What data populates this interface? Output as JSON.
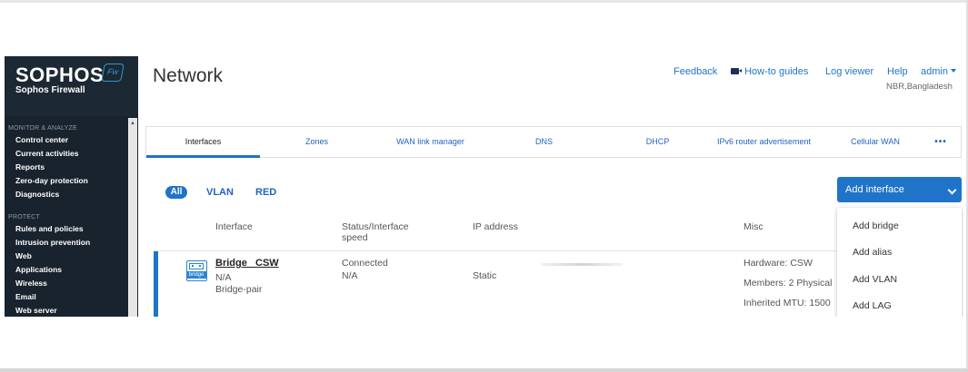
{
  "sidebar": {
    "brand": "SOPHOS",
    "badge": "Fw",
    "subtitle": "Sophos Firewall",
    "sections": [
      {
        "title": "MONITOR & ANALYZE",
        "items": [
          "Control center",
          "Current activities",
          "Reports",
          "Zero-day protection",
          "Diagnostics"
        ]
      },
      {
        "title": "PROTECT",
        "items": [
          "Rules and policies",
          "Intrusion prevention",
          "Web",
          "Applications",
          "Wireless",
          "Email",
          "Web server"
        ]
      }
    ]
  },
  "header": {
    "title": "Network",
    "links": {
      "feedback": "Feedback",
      "howto": "How-to guides",
      "log_viewer": "Log viewer",
      "help": "Help",
      "admin": "admin"
    },
    "location": "NBR,Bangladesh"
  },
  "tabs": [
    "Interfaces",
    "Zones",
    "WAN link manager",
    "DNS",
    "DHCP",
    "IPv6 router advertisement",
    "Cellular WAN",
    "•••"
  ],
  "filters": {
    "all": "All",
    "vlan": "VLAN",
    "red": "RED"
  },
  "add_interface": {
    "label": "Add interface",
    "options": [
      "Add bridge",
      "Add alias",
      "Add VLAN",
      "Add LAG"
    ]
  },
  "table": {
    "columns": {
      "interface": "Interface",
      "status": "Status/Interface\nspeed",
      "ip": "IP address",
      "misc": "Misc"
    },
    "rows": [
      {
        "icon_label": "bridge",
        "name": "Bridge _CSW",
        "sub1": "N/A",
        "sub2": "Bridge-pair",
        "status": "Connected",
        "speed": "N/A",
        "ip": "Static",
        "misc_hardware": "Hardware: CSW",
        "misc_members": "Members: 2 Physical",
        "misc_mtu": "Inherited MTU: 1500"
      }
    ]
  },
  "colors": {
    "accent": "#1f74c9",
    "sidebar_bg": "#18232e",
    "link": "#1f63c2"
  }
}
